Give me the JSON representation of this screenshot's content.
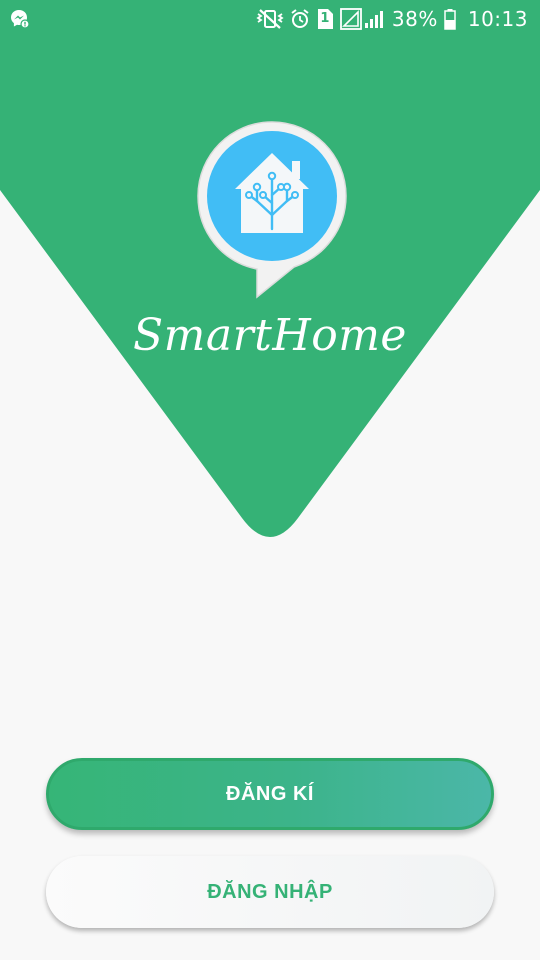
{
  "status_bar": {
    "battery_percent": "38%",
    "time": "10:13",
    "sim_slot": "1",
    "icons": [
      "messenger-icon",
      "mute-vibrate-icon",
      "alarm-icon",
      "sim-icon",
      "signal-icon",
      "battery-icon"
    ]
  },
  "app": {
    "title": "SmartHome",
    "logo_icon": "home-assistant-logo"
  },
  "buttons": {
    "register_label": "ĐĂNG KÍ",
    "login_label": "ĐĂNG NHẬP"
  },
  "colors": {
    "brand_green": "#35b276",
    "logo_blue": "#41bdf5",
    "background": "#f8f8f8"
  }
}
